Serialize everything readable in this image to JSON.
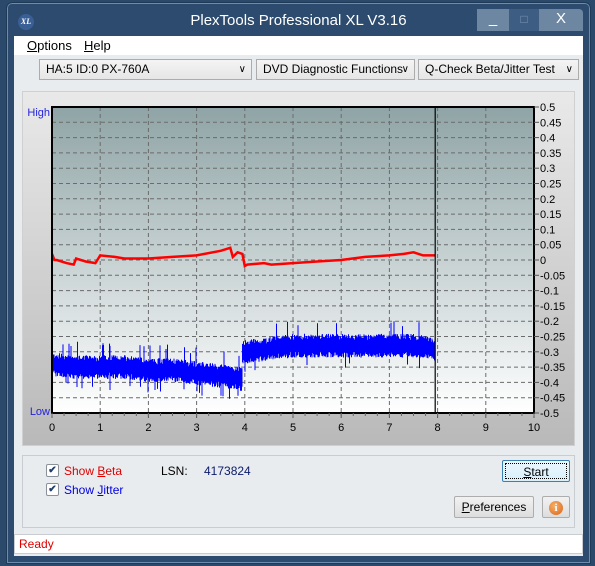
{
  "window": {
    "title": "PlexTools Professional XL V3.16",
    "icon": "XL",
    "controls": {
      "minimize": "_",
      "maximize": "□",
      "close": "X"
    }
  },
  "menu": [
    {
      "label": "Options",
      "accel": "O",
      "rest": "ptions"
    },
    {
      "label": "Help",
      "accel": "H",
      "rest": "elp"
    }
  ],
  "toolbar": {
    "drive": "HA:5 ID:0  PX-760A",
    "function": "DVD Diagnostic Functions",
    "test": "Q-Check Beta/Jitter Test"
  },
  "controls": {
    "show_beta": {
      "pre": "Show ",
      "accel": "B",
      "rest": "eta",
      "checked": true,
      "color": "#e00000"
    },
    "show_jitter": {
      "pre": "Show ",
      "accel": "J",
      "rest": "itter",
      "checked": true,
      "color": "#0000e0"
    },
    "lsn_label": "LSN:",
    "lsn_value": "4173824",
    "start": {
      "accel": "S",
      "rest": "tart"
    },
    "preferences": {
      "accel": "P",
      "rest": "references"
    },
    "info_icon": "i"
  },
  "status": "Ready",
  "chart_data": {
    "type": "line",
    "title": "",
    "left_axis_labels": {
      "top": "High",
      "bottom": "Low"
    },
    "xlim": [
      0,
      10
    ],
    "ylim": [
      -0.5,
      0.5
    ],
    "x_ticks": [
      "0",
      "1",
      "2",
      "3",
      "4",
      "5",
      "6",
      "7",
      "8",
      "9",
      "10"
    ],
    "y_ticks": [
      "0.5",
      "0.45",
      "0.4",
      "0.35",
      "0.3",
      "0.25",
      "0.2",
      "0.15",
      "0.1",
      "0.05",
      "0",
      "-0.05",
      "-0.1",
      "-0.15",
      "-0.2",
      "-0.25",
      "-0.3",
      "-0.35",
      "-0.4",
      "-0.45",
      "-0.5"
    ],
    "grid": true,
    "position_marker_x": 7.95,
    "colors": {
      "beta": "#ff0000",
      "jitter": "#0000ff",
      "bg_top": "#8fa4a6",
      "bg_bottom": "#ffffff"
    },
    "series": [
      {
        "name": "Beta",
        "x": [
          0.0,
          0.05,
          0.1,
          0.3,
          0.45,
          0.5,
          0.7,
          0.9,
          1.0,
          1.3,
          1.5,
          2.0,
          2.5,
          3.0,
          3.5,
          3.7,
          3.75,
          3.85,
          3.95,
          4.0,
          4.05,
          4.4,
          4.55,
          5.0,
          5.5,
          6.0,
          6.5,
          7.0,
          7.3,
          7.5,
          7.7,
          7.95
        ],
        "y": [
          0.02,
          0.0,
          0.0,
          -0.01,
          -0.015,
          0.005,
          -0.005,
          -0.01,
          0.015,
          0.01,
          0.005,
          0.005,
          0.01,
          0.015,
          0.03,
          0.04,
          0.01,
          0.025,
          0.02,
          -0.02,
          -0.015,
          -0.01,
          -0.015,
          -0.01,
          -0.005,
          0.0,
          0.01,
          0.015,
          0.02,
          0.025,
          0.015,
          0.015
        ]
      },
      {
        "name": "Jitter",
        "x": [
          0.0,
          0.5,
          1.0,
          1.5,
          2.0,
          2.5,
          3.0,
          3.5,
          3.95,
          4.0,
          4.5,
          5.0,
          5.5,
          6.0,
          6.5,
          7.0,
          7.5,
          7.95
        ],
        "y": [
          -0.34,
          -0.35,
          -0.35,
          -0.35,
          -0.36,
          -0.36,
          -0.37,
          -0.38,
          -0.39,
          -0.3,
          -0.29,
          -0.28,
          -0.28,
          -0.28,
          -0.28,
          -0.28,
          -0.28,
          -0.29
        ],
        "spread": 0.03
      }
    ]
  }
}
